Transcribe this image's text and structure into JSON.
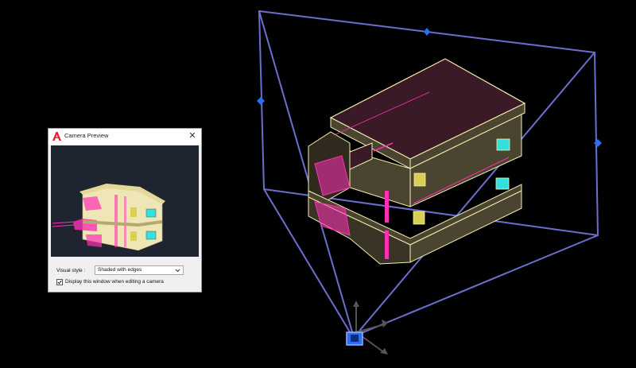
{
  "dialog": {
    "title": "Camera Preview",
    "close_glyph": "✕",
    "visual_style_label": "Visual style :",
    "visual_style_value": "Shaded with edges",
    "display_checkbox_label": "Display this window when editing a camera",
    "display_checkbox_checked": true,
    "logo_icon": "autocad-logo-icon"
  },
  "colors": {
    "background": "#000000",
    "frustum": "#6b6fcf",
    "grip": "#2b6ef5",
    "building_edges": "#f5efb0",
    "roof_fill": "#3a1a26",
    "wall_fill": "#4a4430",
    "magenta": "#ff2fb4",
    "window_cyan": "#33e0e0",
    "preview_bg": "#1f2530",
    "preview_wall": "#efe6b6"
  },
  "camera": {
    "glyph_icon": "camera-icon"
  }
}
